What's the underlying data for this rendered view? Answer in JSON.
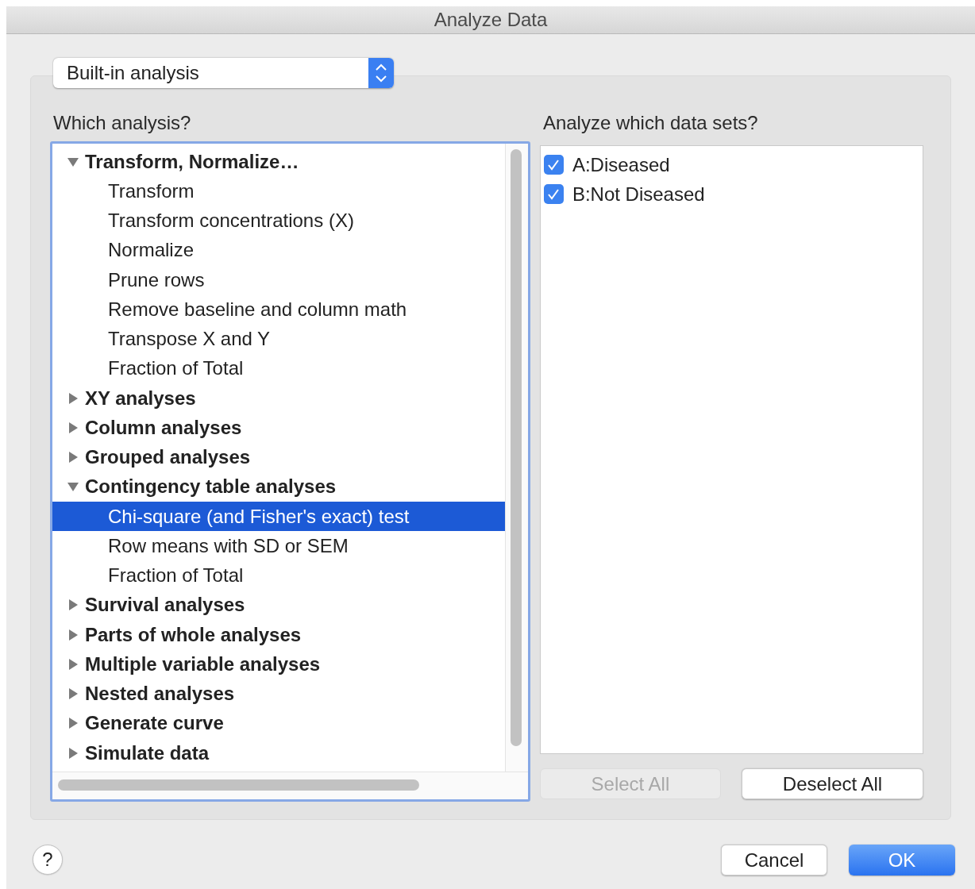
{
  "window": {
    "title": "Analyze Data"
  },
  "analysis_type": {
    "value": "Built-in analysis"
  },
  "which_analysis": {
    "label": "Which analysis?",
    "tree": [
      {
        "label": "Transform, Normalize…",
        "expanded": true,
        "children": [
          {
            "label": "Transform",
            "selected": false
          },
          {
            "label": "Transform concentrations (X)",
            "selected": false
          },
          {
            "label": "Normalize",
            "selected": false
          },
          {
            "label": "Prune rows",
            "selected": false
          },
          {
            "label": "Remove baseline and column math",
            "selected": false
          },
          {
            "label": "Transpose X and Y",
            "selected": false
          },
          {
            "label": "Fraction of Total",
            "selected": false
          }
        ]
      },
      {
        "label": "XY analyses",
        "expanded": false
      },
      {
        "label": "Column analyses",
        "expanded": false
      },
      {
        "label": "Grouped analyses",
        "expanded": false
      },
      {
        "label": "Contingency table analyses",
        "expanded": true,
        "children": [
          {
            "label": "Chi-square (and Fisher's exact) test",
            "selected": true
          },
          {
            "label": "Row means with SD or SEM",
            "selected": false
          },
          {
            "label": "Fraction of Total",
            "selected": false
          }
        ]
      },
      {
        "label": "Survival analyses",
        "expanded": false
      },
      {
        "label": "Parts of whole analyses",
        "expanded": false
      },
      {
        "label": "Multiple variable analyses",
        "expanded": false
      },
      {
        "label": "Nested analyses",
        "expanded": false
      },
      {
        "label": "Generate curve",
        "expanded": false
      },
      {
        "label": "Simulate data",
        "expanded": false
      }
    ]
  },
  "data_sets": {
    "label": "Analyze which data sets?",
    "items": [
      {
        "label": "A:Diseased",
        "checked": true
      },
      {
        "label": "B:Not Diseased",
        "checked": true
      }
    ],
    "buttons": [
      {
        "label": "Select All",
        "disabled": true
      },
      {
        "label": "Deselect All",
        "disabled": false
      }
    ]
  },
  "help": {
    "label": "?"
  },
  "buttons": [
    {
      "label": "Cancel",
      "kind": "normal"
    },
    {
      "label": "OK",
      "kind": "default"
    }
  ]
}
